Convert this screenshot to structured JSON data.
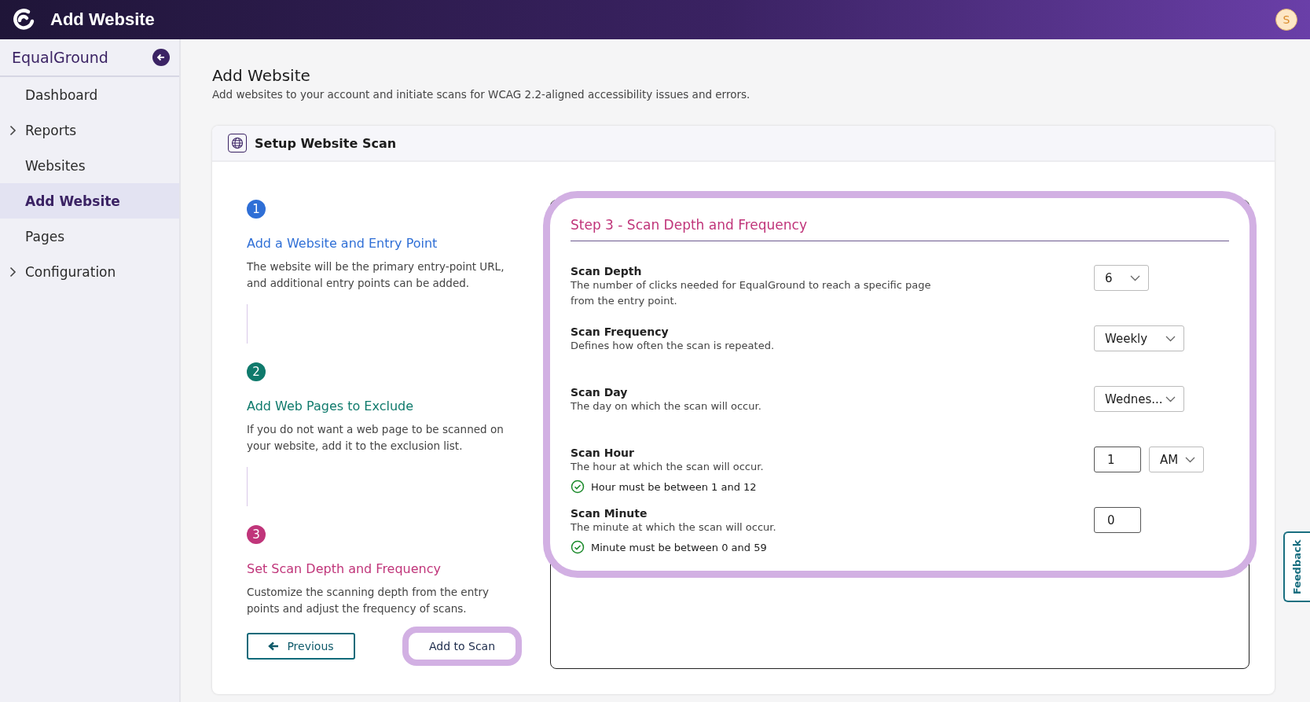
{
  "app_bar": {
    "title": "Add Website",
    "avatar_initial": "S"
  },
  "sidebar": {
    "brand": "EqualGround",
    "items": [
      {
        "label": "Dashboard",
        "selected": false,
        "expandable": false
      },
      {
        "label": "Reports",
        "selected": false,
        "expandable": true
      },
      {
        "label": "Websites",
        "selected": false,
        "expandable": false
      },
      {
        "label": "Add Website",
        "selected": true,
        "expandable": false
      },
      {
        "label": "Pages",
        "selected": false,
        "expandable": false
      },
      {
        "label": "Configuration",
        "selected": false,
        "expandable": true
      }
    ]
  },
  "page": {
    "title": "Add Website",
    "subtitle": "Add websites to your account and initiate scans for WCAG 2.2-aligned accessibility issues and errors."
  },
  "card": {
    "title": "Setup Website Scan",
    "steps": [
      {
        "number": "1",
        "title": "Add a Website and Entry Point",
        "description": "The website will be the primary entry-point URL, and additional entry points can be added.",
        "color": "#2f6fd6"
      },
      {
        "number": "2",
        "title": "Add Web Pages to Exclude",
        "description": "If you do not want a web page to be scanned on your website, add it to the exclusion list.",
        "color": "#0f7a6c"
      },
      {
        "number": "3",
        "title": "Set Scan Depth and Frequency",
        "description": "Customize the scanning depth from the entry points and adjust the frequency of scans.",
        "color": "#c0357a"
      }
    ],
    "buttons": [
      {
        "kind": "back",
        "label": "Previous",
        "highlighted": false
      },
      {
        "kind": "submit",
        "label": "Add to Scan",
        "highlighted": true
      }
    ],
    "panel": {
      "title": "Step 3 - Scan Depth and Frequency",
      "highlighted": true,
      "settings": [
        {
          "label": "Scan Depth",
          "description": "The number of clicks needed for EqualGround to reach a specific page from the entry point.",
          "controls": [
            {
              "kind": "select",
              "value": "6"
            }
          ]
        },
        {
          "label": "Scan Frequency",
          "description": "Defines how often the scan is repeated.",
          "controls": [
            {
              "kind": "select",
              "value": "Weekly"
            }
          ]
        },
        {
          "label": "Scan Day",
          "description": "The day on which the scan will occur.",
          "controls": [
            {
              "kind": "select",
              "value": "Wednes..."
            }
          ]
        },
        {
          "label": "Scan Hour",
          "description": "The hour at which the scan will occur.",
          "controls": [
            {
              "kind": "input",
              "value": "1"
            },
            {
              "kind": "select",
              "value": "AM"
            }
          ],
          "validation": {
            "text": "Hour must be between 1 and 12",
            "valid": true
          }
        },
        {
          "label": "Scan Minute",
          "description": "The minute at which the scan will occur.",
          "controls": [
            {
              "kind": "input",
              "value": "0"
            }
          ],
          "validation": {
            "text": "Minute must be between 0 and 59",
            "valid": true
          }
        }
      ]
    }
  },
  "feedback_tab": {
    "label": "Feedback"
  }
}
